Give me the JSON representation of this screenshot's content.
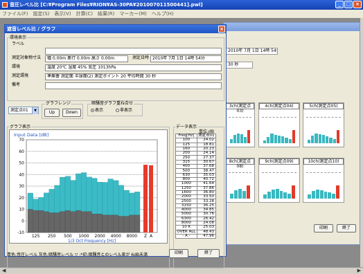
{
  "app": {
    "title": "音圧レベル比 [C:¥Program Files¥RION¥AS-30PA¥201007011500441].pwl]",
    "menus": [
      "ファイル(F)",
      "設定(S)",
      "表示(V)",
      "計算(C)",
      "結果(R)",
      "マーカー(M)",
      "ヘルプ(H)"
    ]
  },
  "background_window": {
    "info1": "2010年 7月 1日 14時 54分",
    "info2": "30  秒",
    "panels": [
      "3ch(測定点03)",
      "4ch(測定点04)",
      "5ch(測定点05)",
      "8ch(測定点08)",
      "9ch(測定点09)",
      "10ch(測定点10)"
    ],
    "print_label": "印刷",
    "close_label": "終了"
  },
  "dialog": {
    "title": "遮音レベル比 / グラフ",
    "env_group": "環境表示",
    "label_row": {
      "label": "ラベル",
      "value": ""
    },
    "dimensions": {
      "label": "測定対象物寸法",
      "value": "幅  0.00m 奥行  0.00m 高さ  0.00m"
    },
    "datetime": {
      "label": "測定日時",
      "value": "2010年 7月 1日 14時 54分"
    },
    "environment": {
      "label": "環境",
      "value": "温度  20℃ 湿度  45% 気圧 1013hPa"
    },
    "measure_env": {
      "label": "測定環境",
      "value": "準無響  測定面    半球面(2)    測定ポイント   20   平均時間    30  秒"
    },
    "note": {
      "label": "備考",
      "value": ""
    },
    "select_value": "測定点01",
    "graph_range": {
      "label": "グラフレンジ",
      "up": "Up",
      "down": "Down"
    },
    "overlay": {
      "label": "暗騒音グラフ重ね合せ",
      "show": "表示",
      "hide": "非表示",
      "selected": "表示"
    },
    "graph_group": "グラフ表示",
    "data_group": "データ表示",
    "unit_label": "単位:dB",
    "status_text": "青色:音圧レベル  灰色:暗騒音レベル  ▽ :*印:暗騒音とのレベル差が 6dB未満",
    "print_label": "印刷",
    "close_label": "終了"
  },
  "colors": {
    "signal": "#3bbbc6",
    "background": "#666666",
    "overall": "#e8392a"
  },
  "chart_data": {
    "type": "bar",
    "title": "Input Data [dB]",
    "xlabel": "1/3 Oct Frequency [Hz]",
    "ylim": [
      -10,
      70
    ],
    "yticks": [
      -10,
      0,
      10,
      20,
      30,
      40,
      50,
      60,
      70
    ],
    "xtick_labels": [
      "125",
      "250",
      "500",
      "1000",
      "2000",
      "4000",
      "8000",
      "Z",
      "A"
    ],
    "categories": [
      "100",
      "125",
      "160",
      "200",
      "250",
      "315",
      "400",
      "500",
      "630",
      "800",
      "1000",
      "1250",
      "1600",
      "2000",
      "2500",
      "3150",
      "4000",
      "5000",
      "6300",
      "8000",
      "10 k"
    ],
    "series": [
      {
        "values": [
          24.02,
          18.81,
          20.23,
          24.14,
          27.37,
          30.67,
          37.68,
          38.47,
          35.03,
          40.72,
          41.64,
          37.86,
          36.8,
          33.5,
          33.28,
          36.25,
          34.85,
          30.76,
          26.42,
          24.08,
          25.03
        ]
      },
      {
        "values": [
          10,
          9,
          9,
          8,
          7,
          7,
          8,
          9,
          8,
          9,
          8,
          8,
          6,
          6,
          5,
          5,
          5,
          4,
          4,
          5,
          5
        ]
      }
    ],
    "overall": {
      "Z": 48.43,
      "A": 47.96
    }
  },
  "table": {
    "headers": [
      "Freq[Hz]",
      "測定点01"
    ],
    "rows": [
      [
        "100",
        "24.02"
      ],
      [
        "125",
        "18.81"
      ],
      [
        "160",
        "20.23"
      ],
      [
        "200",
        "24.14"
      ],
      [
        "250",
        "27.37"
      ],
      [
        "315",
        "30.67"
      ],
      [
        "400",
        "37.68"
      ],
      [
        "500",
        "38.47"
      ],
      [
        "630",
        "35.03"
      ],
      [
        "800",
        "40.72"
      ],
      [
        "1000",
        "41.64"
      ],
      [
        "1250",
        "37.86"
      ],
      [
        "1600",
        "36.80"
      ],
      [
        "2000",
        "33.50"
      ],
      [
        "2500",
        "33.28"
      ],
      [
        "3150",
        "36.25"
      ],
      [
        "4000",
        "34.85"
      ],
      [
        "5000",
        "30.76"
      ],
      [
        "6300",
        "26.42"
      ],
      [
        "8000",
        "24.08"
      ],
      [
        "10 K",
        "25.03"
      ],
      [
        "OVER ALL",
        "48.43"
      ],
      [
        "- A -",
        "47.96"
      ]
    ]
  }
}
